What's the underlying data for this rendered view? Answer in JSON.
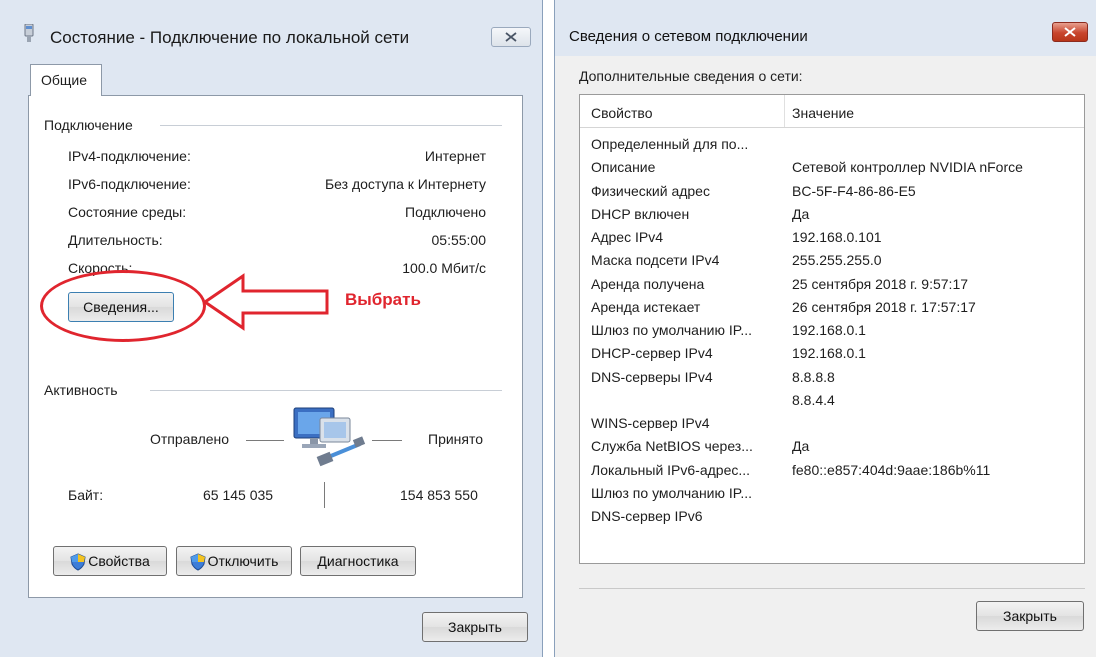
{
  "left_dialog": {
    "title": "Состояние - Подключение по локальной сети",
    "tab": "Общие",
    "connection_group": "Подключение",
    "rows": [
      {
        "key": "IPv4-подключение:",
        "value": "Интернет"
      },
      {
        "key": "IPv6-подключение:",
        "value": "Без доступа к Интернету"
      },
      {
        "key": "Состояние среды:",
        "value": "Подключено"
      },
      {
        "key": "Длительность:",
        "value": "05:55:00"
      },
      {
        "key": "Скорость:",
        "value": "100.0 Мбит/с"
      }
    ],
    "details_button": "Сведения...",
    "annotation": "Выбрать",
    "activity_group": "Активность",
    "sent_label": "Отправлено",
    "received_label": "Принято",
    "bytes_label": "Байт:",
    "bytes_sent": "65 145 035",
    "bytes_received": "154 853 550",
    "buttons": {
      "properties": "Свойства",
      "disable": "Отключить",
      "diagnose": "Диагностика",
      "close": "Закрыть"
    }
  },
  "right_dialog": {
    "title": "Сведения о сетевом подключении",
    "subtitle": "Дополнительные сведения о сети:",
    "columns": [
      "Свойство",
      "Значение"
    ],
    "rows": [
      {
        "property": "Определенный для по...",
        "value": ""
      },
      {
        "property": "Описание",
        "value": "Сетевой контроллер NVIDIA nForce"
      },
      {
        "property": "Физический адрес",
        "value": "BC-5F-F4-86-86-E5"
      },
      {
        "property": "DHCP включен",
        "value": "Да"
      },
      {
        "property": "Адрес IPv4",
        "value": "192.168.0.101"
      },
      {
        "property": "Маска подсети IPv4",
        "value": "255.255.255.0"
      },
      {
        "property": "Аренда получена",
        "value": "25 сентября 2018 г. 9:57:17"
      },
      {
        "property": "Аренда истекает",
        "value": "26 сентября 2018 г. 17:57:17"
      },
      {
        "property": "Шлюз по умолчанию IP...",
        "value": "192.168.0.1"
      },
      {
        "property": "DHCP-сервер IPv4",
        "value": "192.168.0.1"
      },
      {
        "property": "DNS-серверы IPv4",
        "value": "8.8.8.8"
      },
      {
        "property": "",
        "value": "8.8.4.4"
      },
      {
        "property": "WINS-сервер IPv4",
        "value": ""
      },
      {
        "property": "Служба NetBIOS через...",
        "value": "Да"
      },
      {
        "property": "Локальный IPv6-адрес...",
        "value": "fe80::e857:404d:9aae:186b%11"
      },
      {
        "property": "Шлюз по умолчанию IP...",
        "value": ""
      },
      {
        "property": "DNS-сервер IPv6",
        "value": ""
      }
    ],
    "close_button": "Закрыть"
  },
  "colors": {
    "annotation_red": "#e0252e",
    "titlebar_bg": "#dfe7f2",
    "close_red": "#c8452d"
  }
}
